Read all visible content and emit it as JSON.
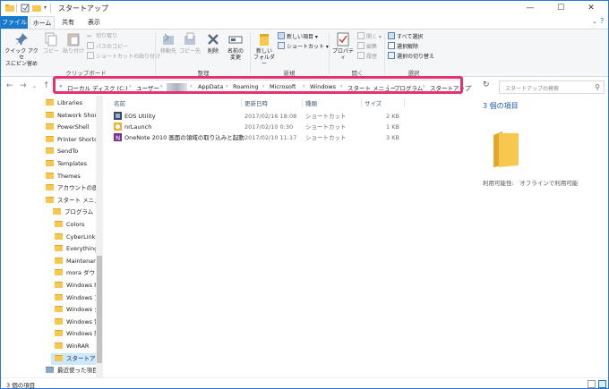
{
  "window": {
    "title": "スタートアップ",
    "controls": {
      "minimize": "—",
      "maximize": "☐",
      "close": "✕"
    }
  },
  "ribbon_tabs": {
    "file": "ファイル",
    "home": "ホーム",
    "share": "共有",
    "view": "表示"
  },
  "ribbon": {
    "pin_quick": "クイック アクセ\nスにピン留め",
    "copy": "コピー",
    "paste": "貼り付け",
    "cut": "切り取り",
    "copy_path": "パスのコピー",
    "paste_shortcut": "ショートカットの貼り付け",
    "move_to": "移動先",
    "copy_to": "コピー先",
    "delete": "削除",
    "rename": "名前の\n変更",
    "new_folder": "新しい\nフォルダー",
    "new_item": "新しい項目",
    "shortcut": "ショートカット",
    "properties": "プロパティ",
    "open": "開く",
    "edit": "編集",
    "history": "履歴",
    "select_all": "すべて選択",
    "select_none": "選択解除",
    "invert_selection": "選択の切り替え",
    "groups": {
      "clipboard": "クリップボード",
      "organize": "整理",
      "new": "新規",
      "open": "開く",
      "select": "選択"
    }
  },
  "address": {
    "breadcrumbs": [
      "ローカル ディスク (C:)",
      "ユーザー",
      "",
      "AppData",
      "Roaming",
      "Microsoft",
      "Windows",
      "スタート メニュー",
      "プログラム",
      "スタートアップ"
    ],
    "prefix": "«",
    "search_placeholder": "スタートアップの検索"
  },
  "nav_pane": {
    "items": [
      {
        "label": "Libraries",
        "indent": 0
      },
      {
        "label": "Network Short",
        "indent": 0
      },
      {
        "label": "PowerShell",
        "indent": 0
      },
      {
        "label": "Printer Shortcu",
        "indent": 0
      },
      {
        "label": "SendTo",
        "indent": 0
      },
      {
        "label": "Templates",
        "indent": 0
      },
      {
        "label": "Themes",
        "indent": 0
      },
      {
        "label": "アカウントの画像",
        "indent": 0
      },
      {
        "label": "スタート メニュー",
        "indent": 0
      },
      {
        "label": "プログラム",
        "indent": 1
      },
      {
        "label": "Colors",
        "indent": 2
      },
      {
        "label": "CyberLink P",
        "indent": 2
      },
      {
        "label": "Everything",
        "indent": 2
      },
      {
        "label": "Maintenanc",
        "indent": 2
      },
      {
        "label": "mora ダウン",
        "indent": 2
      },
      {
        "label": "Windows P",
        "indent": 2
      },
      {
        "label": "Windows ア",
        "indent": 2
      },
      {
        "label": "Windows シ",
        "indent": 2
      },
      {
        "label": "Windows 管",
        "indent": 2
      },
      {
        "label": "Windows 簡",
        "indent": 2
      },
      {
        "label": "WinRAR",
        "indent": 2
      },
      {
        "label": "スタートアップ",
        "indent": 2
      },
      {
        "label": "最近使った項目",
        "indent": 0
      }
    ]
  },
  "file_list": {
    "columns": {
      "name": "名前",
      "modified": "更新日時",
      "type": "種類",
      "size": "サイズ"
    },
    "rows": [
      {
        "name": "EOS Utility",
        "modified": "2017/02/16 18:08",
        "type": "ショートカット",
        "size": "2 KB"
      },
      {
        "name": "nrLaunch",
        "modified": "2017/02/10 0:30",
        "type": "ショートカット",
        "size": "1 KB"
      },
      {
        "name": "OneNote 2010 画面の領域の取り込みと起動",
        "modified": "2017/02/10 11:17",
        "type": "ショートカット",
        "size": "3 KB"
      }
    ]
  },
  "details_pane": {
    "count": "3 個の項目",
    "availability": "利用可能性:　オフラインで利用可能"
  },
  "status_bar": {
    "count": "3 個の項目"
  },
  "colors": {
    "accent": "#1979ca",
    "highlight": "#e8306e",
    "folder": "#f8c84e"
  }
}
